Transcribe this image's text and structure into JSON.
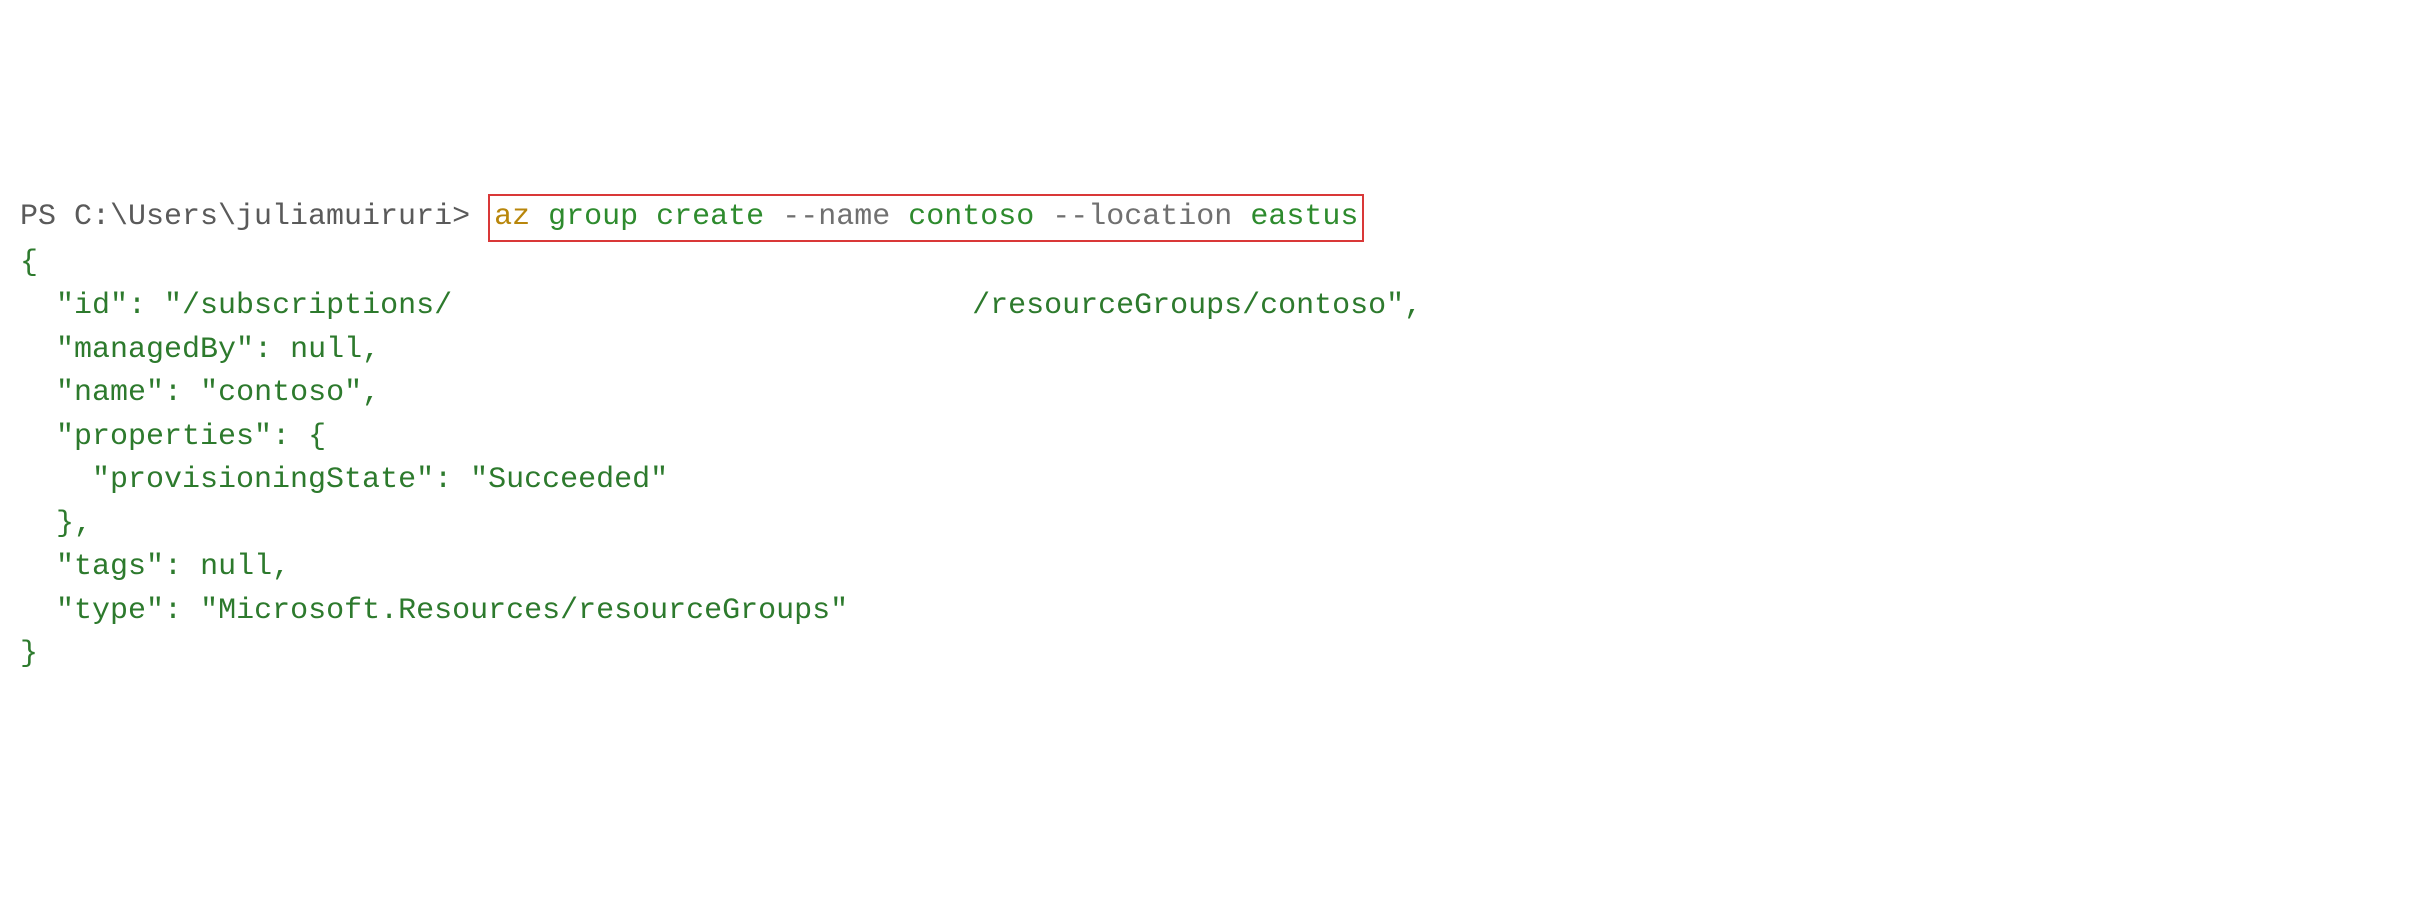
{
  "terminal": {
    "prompt": "PS C:\\Users\\juliamuiruri> ",
    "command": {
      "az": "az",
      "group": "group",
      "create": "create",
      "name_flag": "--name",
      "name_value": "contoso",
      "location_flag": "--location",
      "location_value": "eastus"
    },
    "output": {
      "open_brace": "{",
      "id_key": "\"id\"",
      "id_prefix": "\"/subscriptions/",
      "id_redacted": "                               ",
      "id_suffix": "/resourceGroups/contoso\",",
      "managedBy_key": "\"managedBy\"",
      "managedBy_value": "null,",
      "name_key": "\"name\"",
      "name_value": "\"contoso\",",
      "properties_key": "\"properties\"",
      "properties_open": "{",
      "provisioningState_key": "\"provisioningState\"",
      "provisioningState_value": "\"Succeeded\"",
      "properties_close": "},",
      "tags_key": "\"tags\"",
      "tags_value": "null,",
      "type_key": "\"type\"",
      "type_value": "\"Microsoft.Resources/resourceGroups\"",
      "close_brace": "}"
    }
  }
}
